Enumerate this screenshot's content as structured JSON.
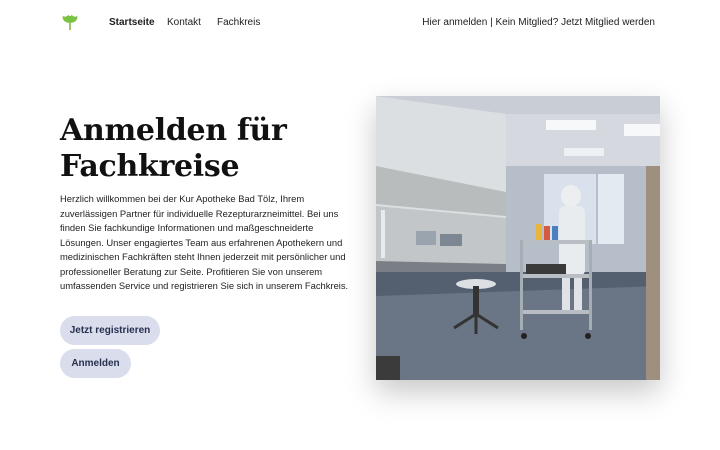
{
  "nav": {
    "logo_icon": "ginkgo-leaf-icon",
    "brand_color": "#7cc242",
    "links": [
      {
        "label": "Startseite",
        "active": true
      },
      {
        "label": "Kontakt",
        "active": false
      },
      {
        "label": "Fachkreis",
        "active": false
      }
    ],
    "auth": {
      "login": "Hier anmelden",
      "separator": " | ",
      "question": "Kein Mitglied? ",
      "register": "Jetzt Mitglied werden"
    }
  },
  "hero": {
    "title_line1": "Anmelden für",
    "title_line2": "Fachkreise",
    "intro": "Herzlich willkommen bei der Kur Apotheke Bad Tölz, Ihrem zuverlässigen Partner für individuelle Rezepturarzneimittel. Bei uns finden Sie fachkundige Informationen und maßgeschneiderte Lösungen. Unser engagiertes Team aus erfahrenen Apothekern und medizinischen Fachkräften steht Ihnen jederzeit mit persönlicher und professioneller Beratung zur Seite. Profitieren Sie von unserem umfassenden Service und registrieren Sie sich in unserem Fachkreis.",
    "register_button": "Jetzt registrieren",
    "login_button": "Anmelden",
    "button_color": "#d9ddec"
  }
}
